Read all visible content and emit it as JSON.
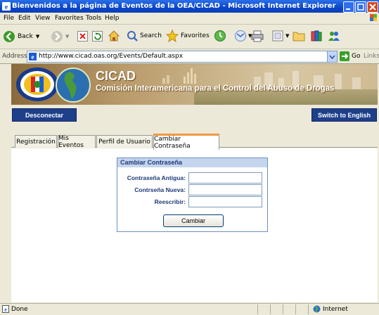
{
  "window": {
    "title": "Bienvenidos a la página de Eventos de la OEA/CICAD - Microsoft Internet Explorer"
  },
  "menu": {
    "items": [
      "File",
      "Edit",
      "View",
      "Favorites",
      "Tools",
      "Help"
    ]
  },
  "toolbar": {
    "back_label": "Back",
    "search_label": "Search",
    "favorites_label": "Favorites"
  },
  "address": {
    "label": "Address",
    "url": "http://www.cicad.oas.org/Events/Default.aspx",
    "go_label": "Go",
    "links_label": "Links"
  },
  "banner": {
    "org_name": "CICAD",
    "org_subtitle": "Comisión Interamericana para el Control del Abuso de Drogas"
  },
  "nav": {
    "logout_label": "Desconectar",
    "language_label": "Switch to English"
  },
  "tabs": [
    {
      "label": "Registración",
      "active": false
    },
    {
      "label": "Mis Eventos",
      "active": false
    },
    {
      "label": "Perfil de Usuario",
      "active": false
    },
    {
      "label": "Cambiar Contraseña",
      "active": true
    }
  ],
  "form": {
    "heading": "Cambiar Contraseña",
    "fields": [
      {
        "label": "Contraseña Antigua:",
        "value": ""
      },
      {
        "label": "Contrseña Nueva:",
        "value": ""
      },
      {
        "label": "Reescribir:",
        "value": ""
      }
    ],
    "submit_label": "Cambiar"
  },
  "status": {
    "text": "Done",
    "zone": "Internet"
  },
  "colors": {
    "title_bar": "#0a46c8",
    "nav_button": "#1e3f8a",
    "active_tab_accent": "#f09840",
    "form_label": "#1e3a7a"
  }
}
